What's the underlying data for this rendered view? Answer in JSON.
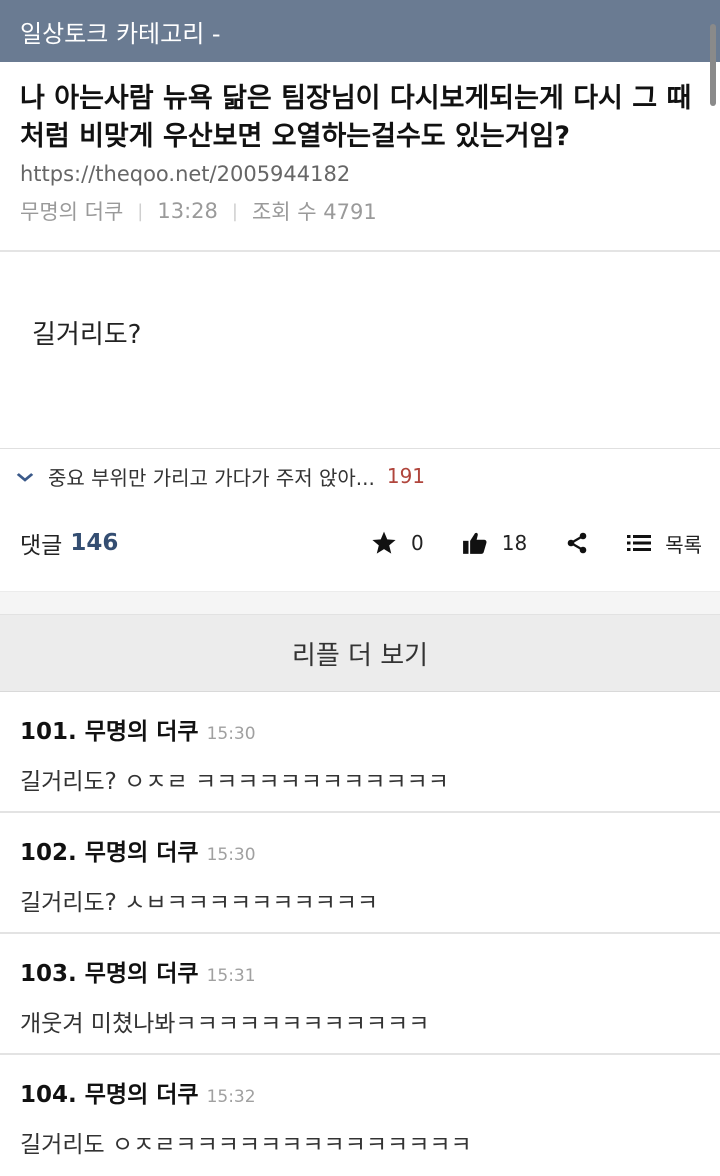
{
  "topbar": {
    "title": "일상토크 카테고리 -"
  },
  "post": {
    "title": "나 아는사람 뉴욕 닮은 팀장님이 다시보게되는게 다시 그 때처럼 비맞게 우산보면 오열하는걸수도 있는거임?",
    "url": "https://theqoo.net/2005944182",
    "author": "무명의 더쿠",
    "time": "13:28",
    "views_label": "조회 수 4791",
    "body": "길거리도?"
  },
  "related": {
    "text": "중요 부위만 가리고 가다가 주저 앉아...",
    "count": "191"
  },
  "actions": {
    "comments_label": "댓글",
    "comments_count": "146",
    "star_count": "0",
    "like_count": "18",
    "list_label": "목록"
  },
  "more_replies_label": "리플 더 보기",
  "comments": [
    {
      "num": "101.",
      "author": "무명의 더쿠",
      "time": "15:30",
      "text": "길거리도? ㅇㅈㄹ ㅋㅋㅋㅋㅋㅋㅋㅋㅋㅋㅋㅋ"
    },
    {
      "num": "102.",
      "author": "무명의 더쿠",
      "time": "15:30",
      "text": "길거리도? ㅅㅂㅋㅋㅋㅋㅋㅋㅋㅋㅋㅋ"
    },
    {
      "num": "103.",
      "author": "무명의 더쿠",
      "time": "15:31",
      "text": "개웃겨 미쳤나봐ㅋㅋㅋㅋㅋㅋㅋㅋㅋㅋㅋㅋ"
    },
    {
      "num": "104.",
      "author": "무명의 더쿠",
      "time": "15:32",
      "text": "길거리도 ㅇㅈㄹㅋㅋㅋㅋㅋㅋㅋㅋㅋㅋㅋㅋㅋㅋ"
    }
  ],
  "colors": {
    "topbar": "#6a7b92",
    "comment_count": "#344e72",
    "related_count": "#b0453c"
  },
  "icons": [
    "chevron-down-icon",
    "star-icon",
    "thumbs-up-icon",
    "share-icon",
    "list-icon"
  ]
}
